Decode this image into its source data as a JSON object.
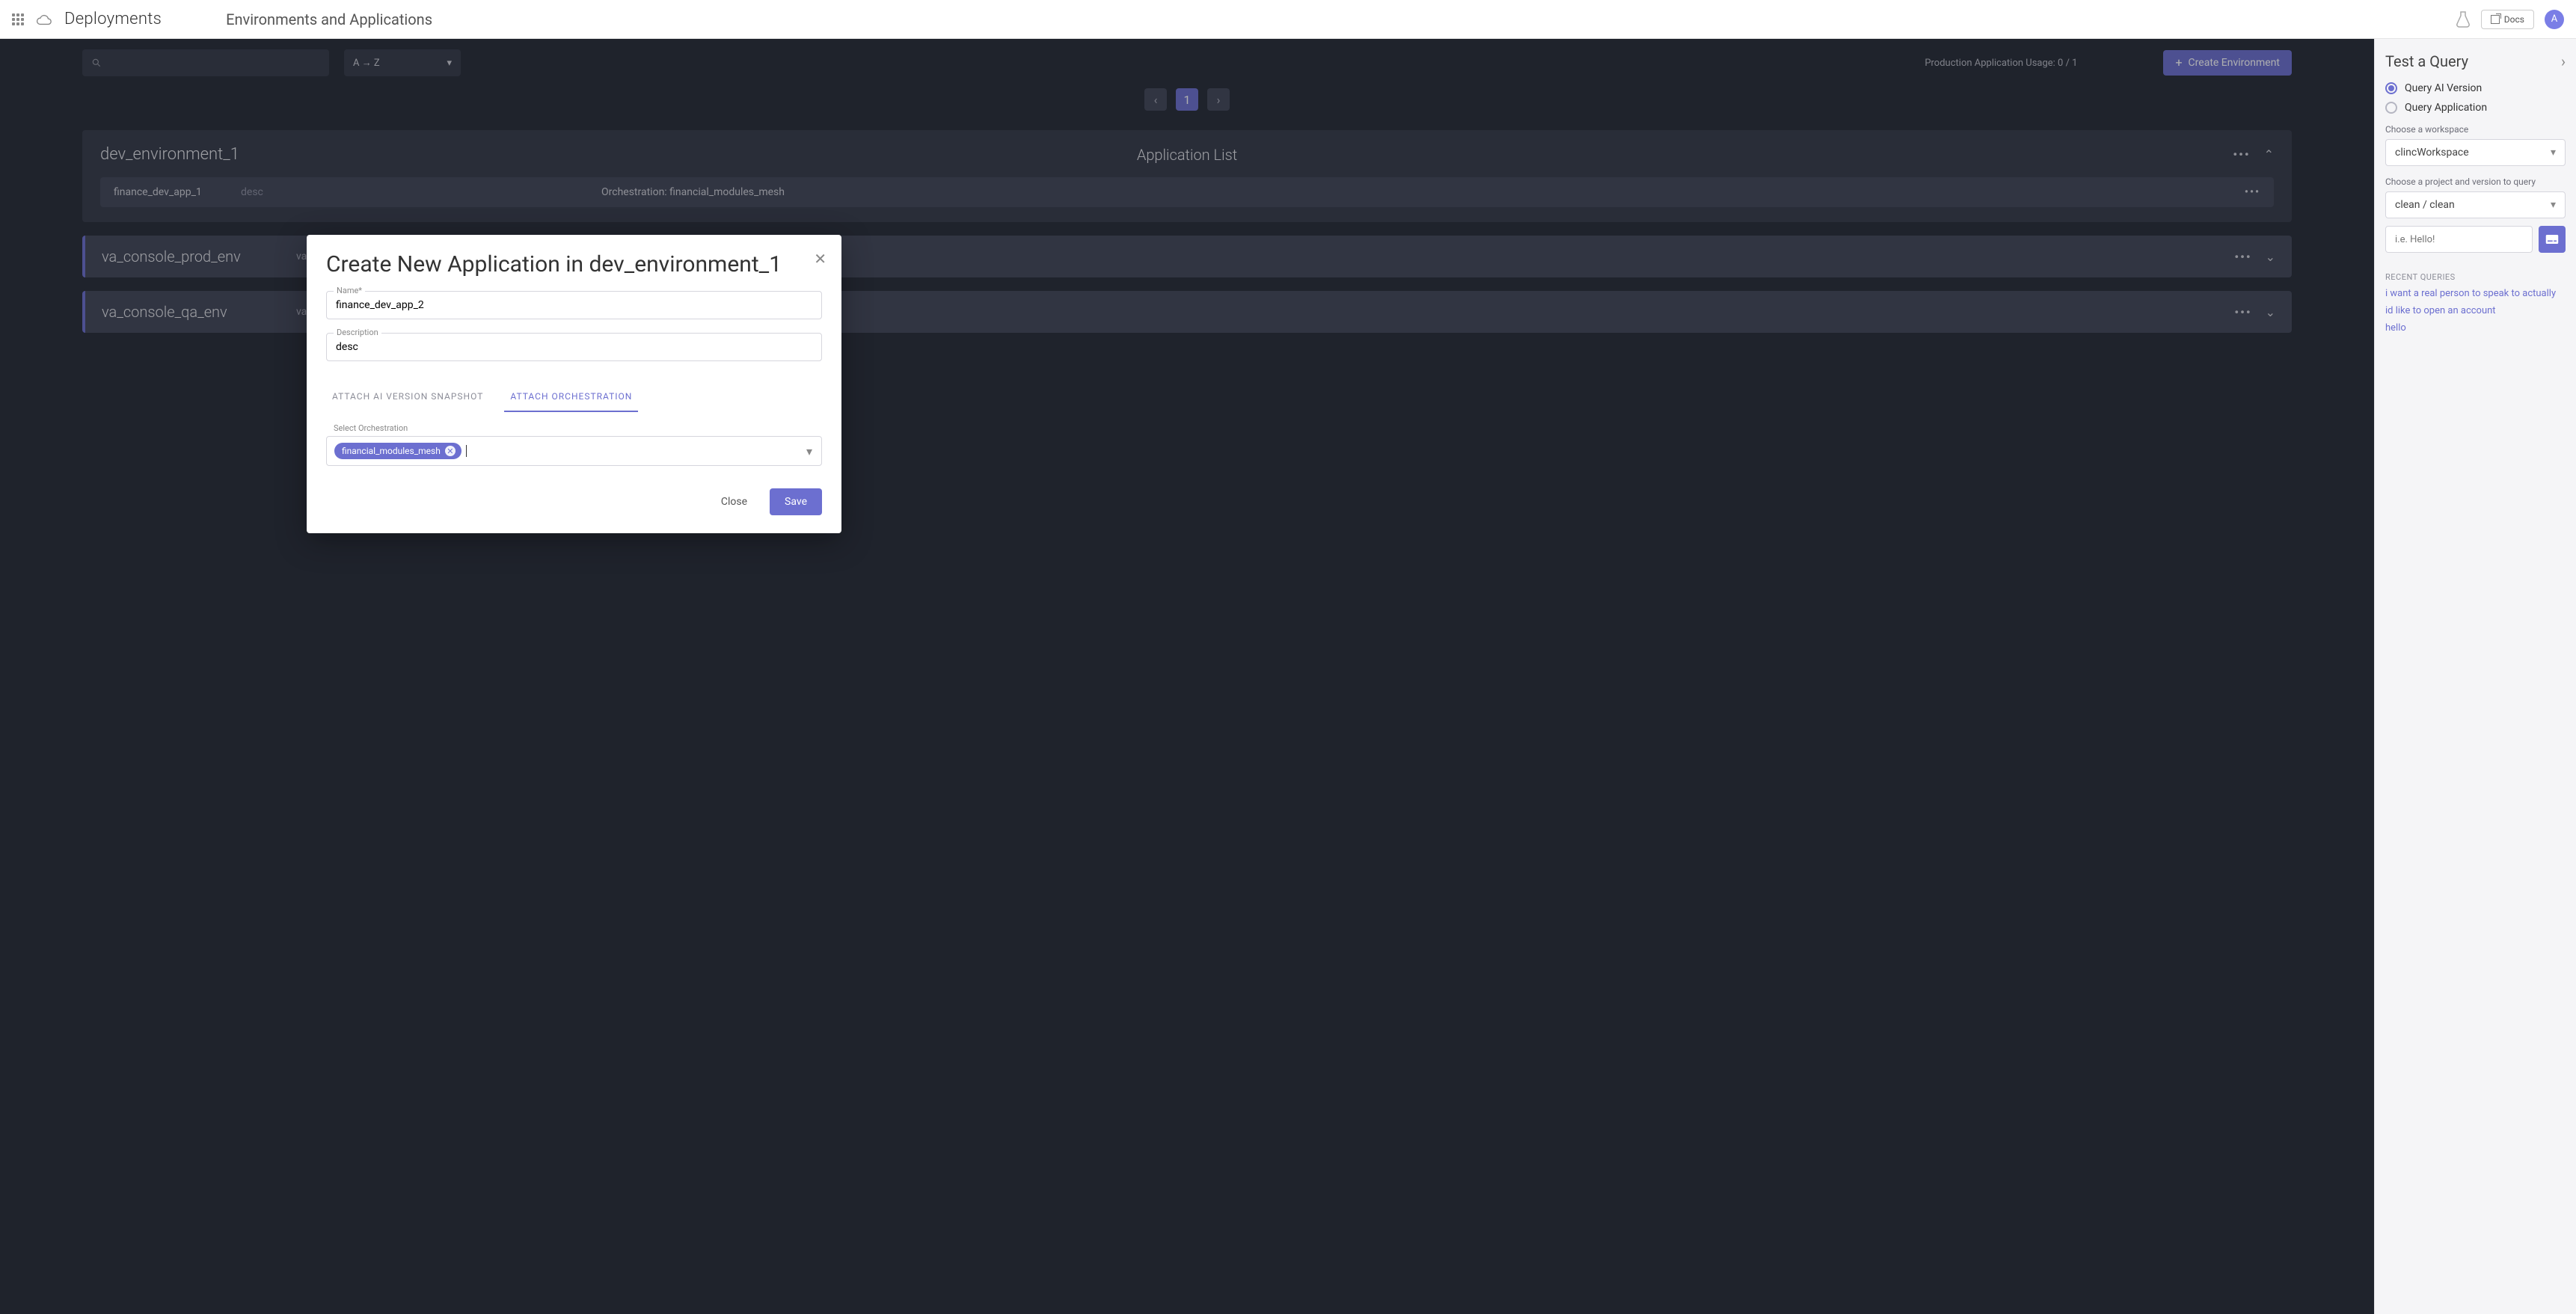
{
  "topbar": {
    "brand": "Deployments",
    "subtitle": "Environments and Applications",
    "docs_label": "Docs",
    "avatar_letter": "A"
  },
  "controls": {
    "sort_label": "A → Z",
    "usage_text": "Production Application Usage: 0 / 1",
    "create_env_label": "Create Environment",
    "page_number": "1"
  },
  "environments": [
    {
      "name": "dev_environment_1",
      "app_list_label": "Application List",
      "apps": [
        {
          "name": "finance_dev_app_1",
          "desc": "desc",
          "orchestration_label": "Orchestration: financial_modules_mesh"
        }
      ]
    },
    {
      "name": "va_console_prod_env",
      "desc": "va console production environment"
    },
    {
      "name": "va_console_qa_env",
      "desc": "va console qa environment"
    }
  ],
  "modal": {
    "title": "Create New Application in dev_environment_1",
    "name_label": "Name*",
    "name_value": "finance_dev_app_2",
    "desc_label": "Description",
    "desc_value": "desc",
    "tab_snapshot": "ATTACH AI VERSION SNAPSHOT",
    "tab_orch": "ATTACH ORCHESTRATION",
    "select_orch_label": "Select Orchestration",
    "chip": "financial_modules_mesh",
    "close_label": "Close",
    "save_label": "Save"
  },
  "rightpanel": {
    "title": "Test a Query",
    "radio_ai": "Query AI Version",
    "radio_app": "Query Application",
    "workspace_label": "Choose a workspace",
    "workspace_value": "clincWorkspace",
    "project_label": "Choose a project and version to query",
    "project_value": "clean / clean",
    "query_placeholder": "i.e. Hello!",
    "recent_header": "RECENT QUERIES",
    "recent": [
      "i want a real person to speak to actually",
      "id like to open an account",
      "hello"
    ]
  }
}
